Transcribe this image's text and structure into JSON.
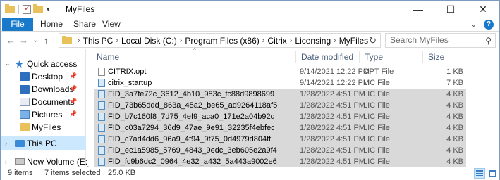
{
  "window": {
    "title": "MyFiles",
    "minimize_glyph": "—",
    "maximize_glyph": "☐",
    "close_glyph": "✕"
  },
  "ribbon": {
    "tabs": [
      "File",
      "Home",
      "Share",
      "View"
    ],
    "expand_glyph": "⌄",
    "help_glyph": "?"
  },
  "address": {
    "back_glyph": "←",
    "forward_glyph": "→",
    "recent_glyph": "⌄",
    "up_glyph": "↑",
    "crumbs": [
      "This PC",
      "Local Disk (C:)",
      "Program Files (x86)",
      "Citrix",
      "Licensing",
      "MyFiles"
    ],
    "separator": "›",
    "refresh_glyph": "↻",
    "dropdown_glyph": "⌄"
  },
  "search": {
    "placeholder": "Search MyFiles",
    "icon_glyph": "⚲"
  },
  "sidebar": {
    "items": [
      {
        "label": "Quick access",
        "icon": "star-icon",
        "pinned": false
      },
      {
        "label": "Desktop",
        "icon": "desktop-icon",
        "pinned": true
      },
      {
        "label": "Downloads",
        "icon": "download-icon",
        "pinned": true
      },
      {
        "label": "Documents",
        "icon": "documents-icon",
        "pinned": true
      },
      {
        "label": "Pictures",
        "icon": "pictures-icon",
        "pinned": true
      },
      {
        "label": "MyFiles",
        "icon": "folder-icon",
        "pinned": false
      },
      {
        "label": "This PC",
        "icon": "computer-icon",
        "pinned": false
      },
      {
        "label": "New Volume (E:)",
        "icon": "drive-icon",
        "pinned": false
      }
    ],
    "pin_glyph": "📌",
    "expand_glyph": "›"
  },
  "columns": {
    "name": "Name",
    "date": "Date modified",
    "type": "Type",
    "size": "Size",
    "sort_glyph": "^"
  },
  "files": [
    {
      "name": "CITRIX.opt",
      "date": "9/14/2021 12:22 PM",
      "type": "OPT File",
      "size": "1 KB",
      "selected": false,
      "kind": "opt"
    },
    {
      "name": "citrix_startup",
      "date": "9/14/2021 12:22 PM",
      "type": "LIC File",
      "size": "7 KB",
      "selected": false,
      "kind": "lic"
    },
    {
      "name": "FID_3a7fe72c_3612_4b10_983c_fc88d9898699",
      "date": "1/28/2022 4:51 PM",
      "type": "LIC File",
      "size": "4 KB",
      "selected": true,
      "kind": "lic"
    },
    {
      "name": "FID_73b65ddd_863a_45a2_be65_ad9264118af5",
      "date": "1/28/2022 4:51 PM",
      "type": "LIC File",
      "size": "4 KB",
      "selected": true,
      "kind": "lic"
    },
    {
      "name": "FID_b7c160f8_7d75_4ef9_aca0_171e2a04b92d",
      "date": "1/28/2022 4:51 PM",
      "type": "LIC File",
      "size": "4 KB",
      "selected": true,
      "kind": "lic"
    },
    {
      "name": "FID_c03a7294_36d9_47ae_9e91_32235f4ebfec",
      "date": "1/28/2022 4:51 PM",
      "type": "LIC File",
      "size": "4 KB",
      "selected": true,
      "kind": "lic"
    },
    {
      "name": "FID_c7ad4dd6_96a9_4f94_9f75_0d4979d804ff",
      "date": "1/28/2022 4:51 PM",
      "type": "LIC File",
      "size": "4 KB",
      "selected": true,
      "kind": "lic"
    },
    {
      "name": "FID_ec1a5985_5769_4843_9edc_3eb605e2a9f4",
      "date": "1/28/2022 4:51 PM",
      "type": "LIC File",
      "size": "4 KB",
      "selected": true,
      "kind": "lic"
    },
    {
      "name": "FID_fc9b6dc2_0964_4e32_a432_5a443a9002e6",
      "date": "1/28/2022 4:51 PM",
      "type": "LIC File",
      "size": "4 KB",
      "selected": true,
      "kind": "lic"
    }
  ],
  "status": {
    "count": "9 items",
    "selected": "7 items selected",
    "size": "25.0 KB"
  },
  "colors": {
    "accent": "#1979ca",
    "selection": "#d9d9d9",
    "nav_selection": "#cce8ff",
    "folder": "#e8c15a"
  }
}
